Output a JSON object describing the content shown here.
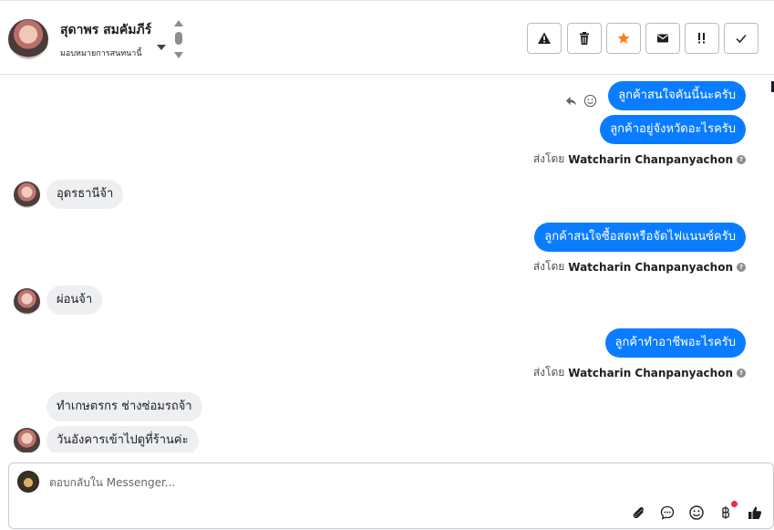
{
  "header": {
    "contact_name": "สุดาพร สมคัมภีร์",
    "assign_label": "มอบหมายการสนทนานี้",
    "toolbar": [
      {
        "name": "spam-button",
        "icon": "warning-icon"
      },
      {
        "name": "delete-button",
        "icon": "trash-icon"
      },
      {
        "name": "star-button",
        "icon": "star-icon",
        "color": "#f5831f"
      },
      {
        "name": "mark-unread-button",
        "icon": "envelope-icon"
      },
      {
        "name": "follow-up-button",
        "icon": "follow-up-icon"
      },
      {
        "name": "done-button",
        "icon": "check-icon"
      }
    ]
  },
  "messages": [
    {
      "dir": "out",
      "text": "ลูกค้าสนใจคันนี้นะครับ"
    },
    {
      "dir": "out",
      "text": "ลูกค้าอยู่จังหวัดอะไรครับ"
    },
    {
      "dir": "meta",
      "label": "ส่งโดย",
      "name": "Watcharin Chanpanyachon"
    },
    {
      "dir": "in",
      "text": "อุดรธานีจ้า"
    },
    {
      "dir": "out",
      "text": "ลูกค้าสนใจซื้อสดหรือจัดไฟแนนซ์ครับ"
    },
    {
      "dir": "meta",
      "label": "ส่งโดย",
      "name": "Watcharin Chanpanyachon"
    },
    {
      "dir": "in",
      "text": "ผ่อนจ้า"
    },
    {
      "dir": "out",
      "text": "ลูกค้าทำอาชีพอะไรครับ"
    },
    {
      "dir": "meta",
      "label": "ส่งโดย",
      "name": "Watcharin Chanpanyachon"
    },
    {
      "dir": "in",
      "text": "ทำเกษตรกร ช่างซ่อมรถจ้า"
    },
    {
      "dir": "in",
      "text": "วันอังคารเข้าไปดูที่ร้านค่ะ"
    }
  ],
  "composer": {
    "placeholder": "ตอบกลับใน Messenger...",
    "icons": [
      "attach-icon",
      "saved-replies-icon",
      "emoji-icon",
      "baht-icon",
      "like-icon"
    ],
    "notification_color": "#f02849"
  },
  "colors": {
    "outgoing_bubble": "#0a7cff",
    "incoming_bubble": "#eeeff1"
  }
}
